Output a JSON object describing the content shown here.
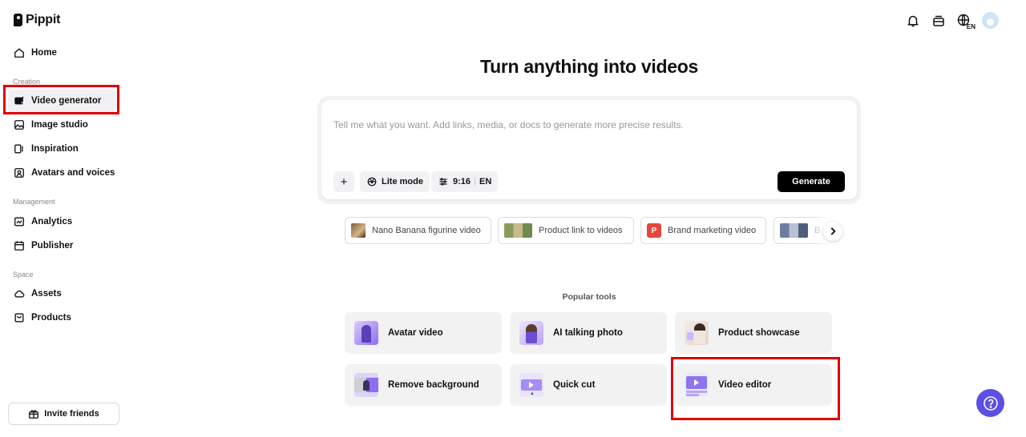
{
  "app": {
    "name": "Pippit"
  },
  "sidebar": {
    "home": "Home",
    "sections": {
      "creation": "Creation",
      "management": "Management",
      "space": "Space"
    },
    "creation_items": [
      {
        "label": "Video generator",
        "icon": "video-generator-icon",
        "active": true
      },
      {
        "label": "Image studio",
        "icon": "image-studio-icon"
      },
      {
        "label": "Inspiration",
        "icon": "inspiration-icon"
      },
      {
        "label": "Avatars and voices",
        "icon": "avatar-voice-icon"
      }
    ],
    "management_items": [
      {
        "label": "Analytics",
        "icon": "analytics-icon"
      },
      {
        "label": "Publisher",
        "icon": "calendar-icon"
      }
    ],
    "space_items": [
      {
        "label": "Assets",
        "icon": "cloud-icon"
      },
      {
        "label": "Products",
        "icon": "bag-icon"
      }
    ],
    "invite": "Invite friends"
  },
  "topbar": {
    "icons": [
      "bell-icon",
      "inbox-icon",
      "globe-icon",
      "avatar"
    ],
    "language": "EN"
  },
  "main": {
    "title": "Turn anything into videos",
    "prompt": {
      "placeholder": "Tell me what you want. Add links, media, or docs to generate more precise results.",
      "add_label": "+",
      "mode_label": "Lite mode",
      "ratio_label": "9:16",
      "lang_label": "EN",
      "generate_label": "Generate"
    },
    "suggestions": [
      "Nano Banana figurine video",
      "Product link to videos",
      "Brand marketing video",
      "B"
    ],
    "popular_label": "Popular tools",
    "tools": [
      "Avatar video",
      "AI talking photo",
      "Product showcase",
      "Remove background",
      "Quick cut",
      "Video editor"
    ]
  },
  "colors": {
    "highlight": "#e00000",
    "accent": "#5b4fe5",
    "card_bg": "#f2f2f3"
  }
}
